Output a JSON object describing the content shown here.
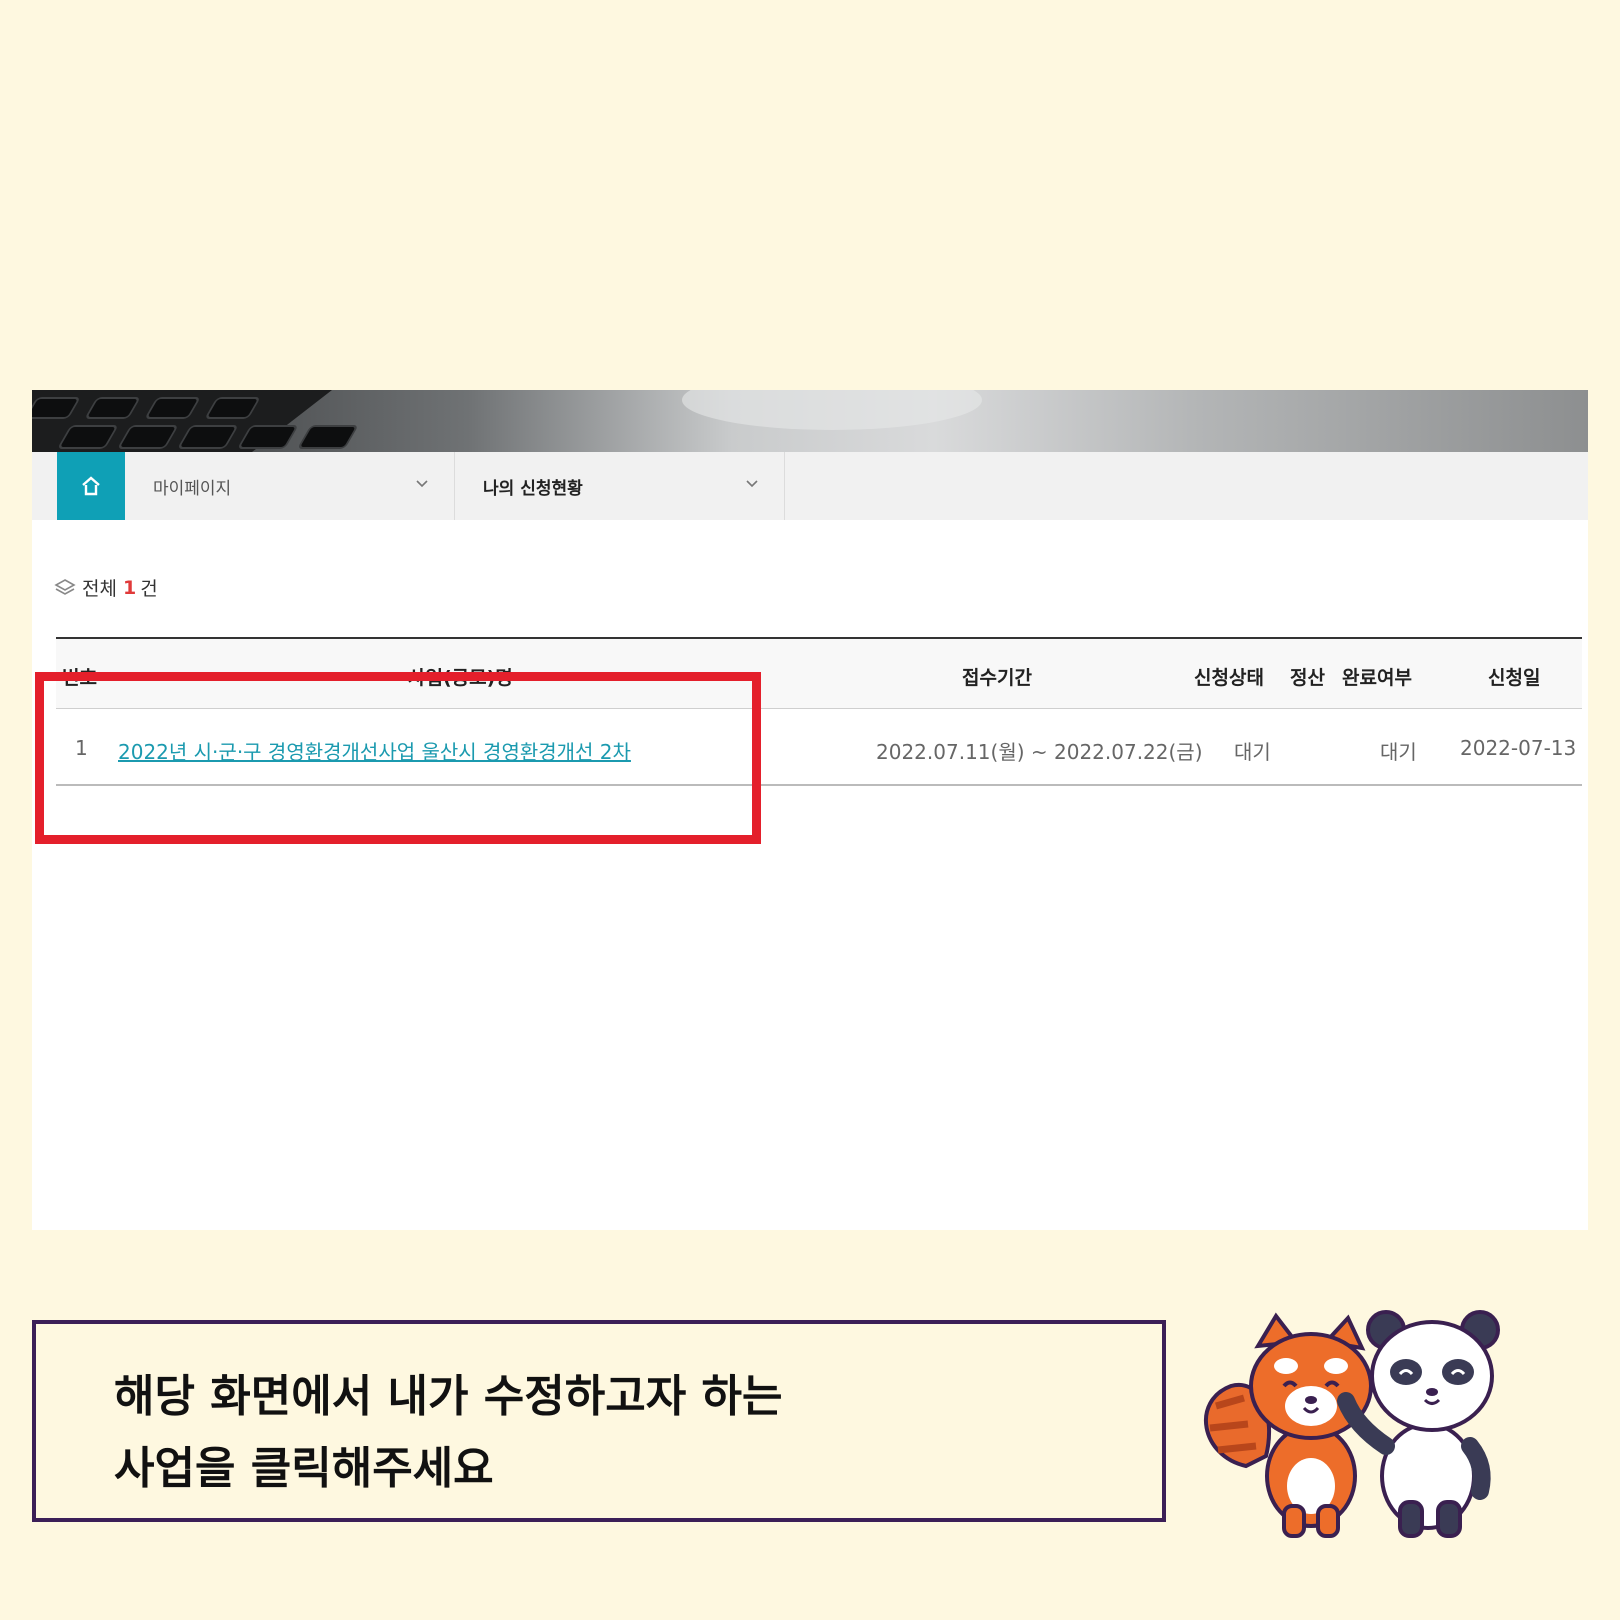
{
  "nav": {
    "level1": "마이페이지",
    "level2": "나의 신청현황"
  },
  "summary": {
    "label": "전체",
    "count": "1",
    "unit": "건"
  },
  "table": {
    "headers": [
      "번호",
      "사업(공모)명",
      "접수기간",
      "신청상태",
      "정산",
      "완료여부",
      "신청일"
    ],
    "rows": [
      {
        "no": "1",
        "title": "2022년 시·군·구 경영환경개선사업 울산시 경영환경개선 2차",
        "period": "2022.07.11(월) ~ 2022.07.22(금)",
        "status": "대기",
        "settlement": "",
        "completion": "대기",
        "date": "2022-07-13"
      }
    ]
  },
  "caption": {
    "line1": "해당 화면에서 내가 수정하고자 하는",
    "line2": "사업을 클릭해주세요"
  },
  "colors": {
    "background": "#fef8e0",
    "accent": "#0fa0b6",
    "highlight": "#e41f2b",
    "caption_border": "#3c1f57",
    "count": "#e03a3a"
  },
  "icons": [
    "home-icon",
    "chevron-down-icon",
    "layers-icon"
  ]
}
